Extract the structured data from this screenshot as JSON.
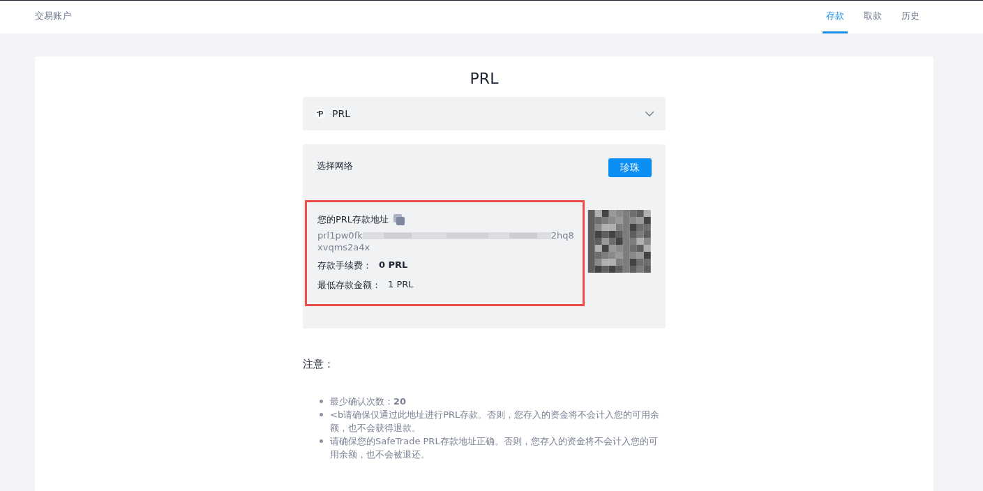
{
  "header": {
    "title": "交易账户",
    "tabs": [
      {
        "label": "存款",
        "selected": true
      },
      {
        "label": "取款",
        "selected": false
      },
      {
        "label": "历史",
        "selected": false
      }
    ]
  },
  "card": {
    "title": "PRL",
    "currency_select": {
      "value": "PRL"
    },
    "network": {
      "label": "选择网络",
      "button": "珍珠",
      "address": {
        "label": "您的PRL存款地址",
        "start": "prl1pw0fk",
        "end": "2hq8",
        "line_2": "xvqms2a4x"
      },
      "fee": {
        "label": "存款手续费：",
        "value": "0 PRL"
      },
      "minimum": {
        "label": "最低存款金额：",
        "value": "1 PRL"
      }
    },
    "notice": {
      "title": "注意：",
      "items": [
        "最少确认次数：**20**",
        "<b请确保仅通过此地址进行PRL存款。否则，您存入的资金将不会计入您的可用余额，也不会获得退款。",
        "请确保您的SafeTrade PRL存款地址正确。否则，您存入的资金将不会计入您的可用余额，也不会被退还。"
      ]
    }
  }
}
